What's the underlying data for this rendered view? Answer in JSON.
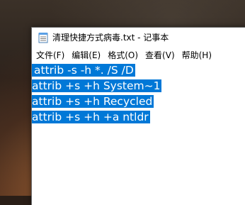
{
  "window": {
    "title": "清理快捷方式病毒.txt - 记事本",
    "icon": "notepad-icon"
  },
  "menu": [
    {
      "label": "文件(F)"
    },
    {
      "label": "编辑(E)"
    },
    {
      "label": "格式(O)"
    },
    {
      "label": "查看(V)"
    },
    {
      "label": "帮助(H)"
    }
  ],
  "editor": {
    "lines": [
      "attrib -s -h *. /S /D",
      "attrib +s +h System~1",
      "attrib +s +h Recycled",
      "attrib +s +h +a ntldr"
    ],
    "selection_color": "#0078d7",
    "selected_text_color": "#ffffff"
  }
}
